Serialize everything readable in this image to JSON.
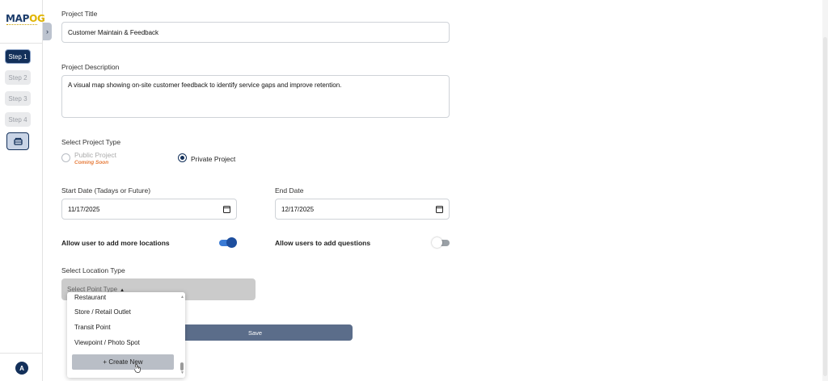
{
  "sidebar": {
    "logo_main": "MAP",
    "logo_accent": "OG",
    "collapse_icon": "chevron-right-icon",
    "steps": [
      {
        "label": "Step 1",
        "active": true
      },
      {
        "label": "Step 2",
        "active": false
      },
      {
        "label": "Step 3",
        "active": false
      },
      {
        "label": "Step 4",
        "active": false
      }
    ],
    "special_step_icon": "layers-icon",
    "avatar_initial": "A"
  },
  "form": {
    "title_label": "Project Title",
    "title_value": "Customer Maintain & Feedback",
    "description_label": "Project Description",
    "description_value": "A visual map showing on-site customer feedback to identify service gaps and improve retention.",
    "project_type_label": "Select Project Type",
    "project_types": [
      {
        "label": "Public Project",
        "note": "Coming Soon",
        "selected": false,
        "disabled": true
      },
      {
        "label": "Private Project",
        "note": "",
        "selected": true,
        "disabled": false
      }
    ],
    "start_date_label": "Start Date (Tadays or Future)",
    "start_date_value": "11/17/2025",
    "end_date_label": "End Date",
    "end_date_value": "12/17/2025",
    "allow_locations_label": "Allow user to add more locations",
    "allow_locations_on": true,
    "allow_questions_label": "Allow users to add questions",
    "allow_questions_on": false,
    "location_type_label": "Select Location Type",
    "location_type_placeholder": "Select Point Type",
    "save_label": "Save"
  },
  "dropdown": {
    "items": [
      "Restaurant",
      "Store / Retail Outlet",
      "Transit Point",
      "Viewpoint / Photo Spot"
    ],
    "create_label": "+ Create New"
  },
  "colors": {
    "primary": "#13305a",
    "toggle_on": "#1d4e9e",
    "coming_soon": "#e67b3a",
    "save_button": "#5b6d8a"
  }
}
